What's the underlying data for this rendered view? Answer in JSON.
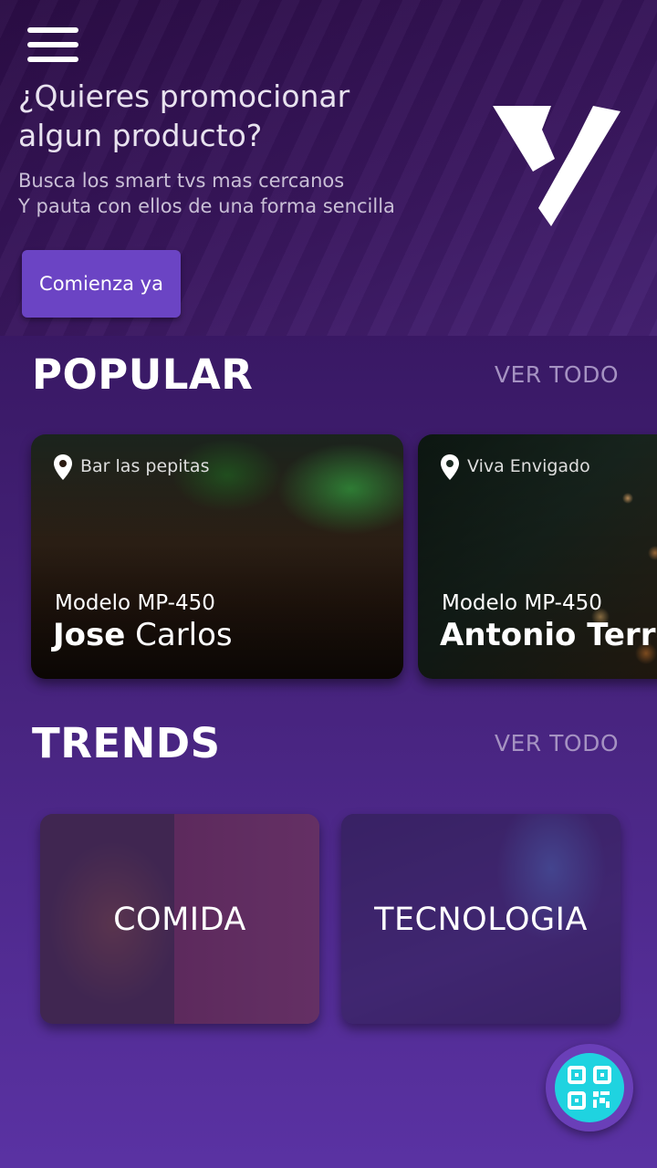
{
  "header": {
    "menu_icon": "hamburger-menu-icon",
    "title": "¿Quieres promocionar algun producto?",
    "subtitle_line1": "Busca los smart tvs mas cercanos",
    "subtitle_line2": "Y pauta con ellos de una forma sencilla",
    "cta_label": "Comienza ya",
    "logo_icon": "brand-logo-icon"
  },
  "popular": {
    "title": "POPULAR",
    "see_all": "VER TODO",
    "cards": [
      {
        "place": "Bar las pepitas",
        "model": "Modelo MP-450",
        "first_name": "Jose",
        "last_name": " Carlos"
      },
      {
        "place": "Viva Envigado",
        "model": "Modelo MP-450",
        "first_name": "Antonio",
        "last_name": " Terro"
      }
    ]
  },
  "trends": {
    "title": "TRENDS",
    "see_all": "VER TODO",
    "cards": [
      {
        "label": "COMIDA"
      },
      {
        "label": "TECNOLOGIA"
      }
    ]
  },
  "fab": {
    "icon": "qr-code-icon"
  },
  "colors": {
    "accent": "#6b44c4",
    "fab": "#1fd3e0",
    "muted": "#a592c2"
  }
}
